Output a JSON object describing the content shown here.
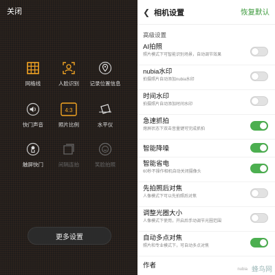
{
  "left": {
    "close_label": "关闭",
    "grid": [
      {
        "icon": "grid-icon",
        "label": "网格线",
        "dim": false
      },
      {
        "icon": "face-recognition-icon",
        "label": "人脸识别",
        "dim": false
      },
      {
        "icon": "location-pin-icon",
        "label": "记录位置信息",
        "dim": false
      },
      {
        "icon": "shutter-sound-icon",
        "label": "快门声音",
        "dim": false
      },
      {
        "icon": "aspect-ratio-icon",
        "label": "照片比例",
        "dim": false,
        "text": "4:3"
      },
      {
        "icon": "level-icon",
        "label": "水平仪",
        "dim": false
      },
      {
        "icon": "touch-shutter-icon",
        "label": "触屏快门",
        "dim": false
      },
      {
        "icon": "burst-icon",
        "label": "间隔连拍",
        "dim": true
      },
      {
        "icon": "smile-icon",
        "label": "笑脸拍照",
        "dim": true
      }
    ],
    "more_settings": "更多设置"
  },
  "right": {
    "title": "相机设置",
    "restore": "恢复默认",
    "section": "高级设置",
    "rows": [
      {
        "title": "AI拍照",
        "desc": "照片模式下可智能识别场景，自动调节效果",
        "on": false
      },
      {
        "title": "nubia水印",
        "desc": "拍摄照片自动添加nubia水印",
        "on": false
      },
      {
        "title": "时间水印",
        "desc": "拍摄照片自动添加时间水印",
        "on": false
      },
      {
        "title": "急速抓拍",
        "desc": "熄屏状态下双击音量键可完成抓拍",
        "on": true
      },
      {
        "title": "智能降噪",
        "desc": "",
        "on": true
      },
      {
        "title": "智能省电",
        "desc": "60秒不操作相机自动关闭摄像头",
        "on": true
      },
      {
        "title": "先拍照后对焦",
        "desc": "人像模式下可以先拍照后对焦",
        "on": false
      },
      {
        "title": "调整光圈大小",
        "desc": "人像模式下使用，开启后手动调节光圈范围",
        "on": false
      },
      {
        "title": "自动多点对焦",
        "desc": "照片和专业模式下，可自动多点对焦",
        "on": true
      },
      {
        "title": "作者",
        "desc": "",
        "on": null
      }
    ],
    "watermark": "蜂鸟网",
    "nubia_tag": "nubia"
  },
  "colors": {
    "accent": "#f5a623",
    "toggle_on": "#4caf50",
    "restore": "#3d9a3d"
  }
}
